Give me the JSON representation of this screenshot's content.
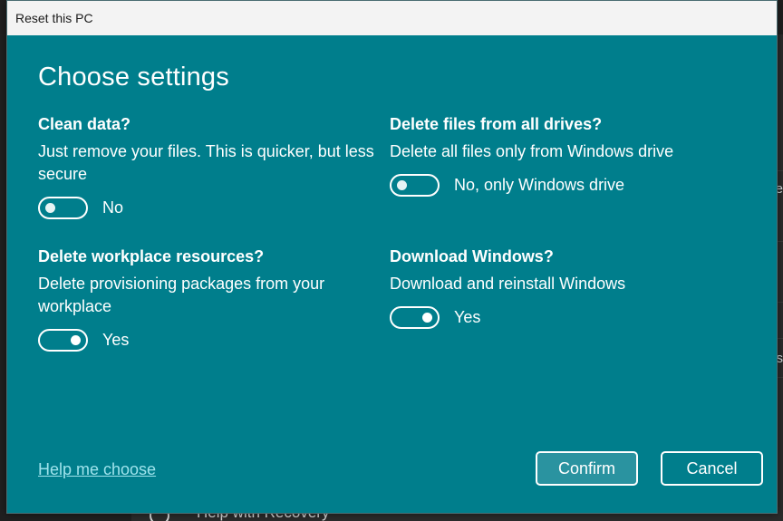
{
  "background": {
    "right_edge_chars": [
      "e",
      "s"
    ],
    "footer_text": "Help with Recovery"
  },
  "dialog": {
    "title": "Reset this PC",
    "heading": "Choose settings",
    "settings": {
      "clean_data": {
        "question": "Clean data?",
        "description": "Just remove your files. This is quicker, but less secure",
        "state": "No",
        "on": false
      },
      "delete_all_drives": {
        "question": "Delete files from all drives?",
        "description": "Delete all files only from Windows drive",
        "state": "No, only Windows drive",
        "on": false
      },
      "delete_workplace": {
        "question": "Delete workplace resources?",
        "description": "Delete provisioning packages from your workplace",
        "state": "Yes",
        "on": true
      },
      "download_windows": {
        "question": "Download Windows?",
        "description": "Download and reinstall Windows",
        "state": "Yes",
        "on": true
      }
    },
    "help_link": "Help me choose",
    "confirm_label": "Confirm",
    "cancel_label": "Cancel"
  },
  "colors": {
    "dialog_bg": "#007e8c",
    "confirm_bg": "#2a93a0",
    "link": "#9fe3ec"
  }
}
